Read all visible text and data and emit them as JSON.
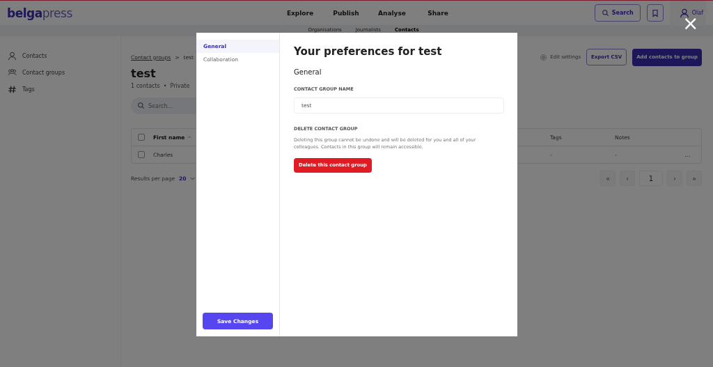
{
  "header": {
    "logo_main": "belga",
    "logo_rest": "press",
    "nav": [
      {
        "label": "Explore"
      },
      {
        "label": "Publish"
      },
      {
        "label": "Analyse"
      },
      {
        "label": "Share"
      }
    ],
    "search_button": "Search",
    "user": "Olaf"
  },
  "subnav": [
    {
      "label": "Organisations",
      "selected": false
    },
    {
      "label": "Journalists",
      "selected": false
    },
    {
      "label": "Contacts",
      "selected": true
    }
  ],
  "sidebar": [
    {
      "label": "Contacts",
      "kind": "person"
    },
    {
      "label": "Contact groups",
      "kind": "group"
    },
    {
      "label": "Tags",
      "kind": "hash"
    }
  ],
  "breadcrumb": {
    "parent": "Contact groups",
    "separator": ">",
    "current": "test"
  },
  "page": {
    "title": "test",
    "count": "1 contacts",
    "dot": "•",
    "visibility": "Private",
    "search_placeholder": "Search...",
    "edit_settings": "Edit settings",
    "export": "Export CSV",
    "add": "Add contacts to group"
  },
  "table": {
    "columns": [
      "First name",
      "Tags",
      "Notes"
    ],
    "header_checked": false,
    "rows": [
      {
        "checked": false,
        "first_name": "Charles",
        "tags": "-",
        "notes": "-",
        "menu": "..."
      }
    ]
  },
  "footer": {
    "results_label": "Results per page",
    "results_value": "20",
    "pages": [
      "«",
      "‹",
      "1",
      "›",
      "»"
    ]
  },
  "modal": {
    "close": "×",
    "tabs": [
      {
        "label": "General",
        "selected": true
      },
      {
        "label": "Collaboration",
        "selected": false
      }
    ],
    "save": "Save Changes",
    "title": "Your preferences for test",
    "section": "General",
    "name_label": "CONTACT GROUP NAME",
    "name_value": "test",
    "delete_label": "DELETE CONTACT GROUP",
    "delete_text": "Deleting this group cannot be undone and will be deleted for you and all of your colleagues. Contacts in this group will remain accessible.",
    "delete_button": "Delete this contact group"
  }
}
